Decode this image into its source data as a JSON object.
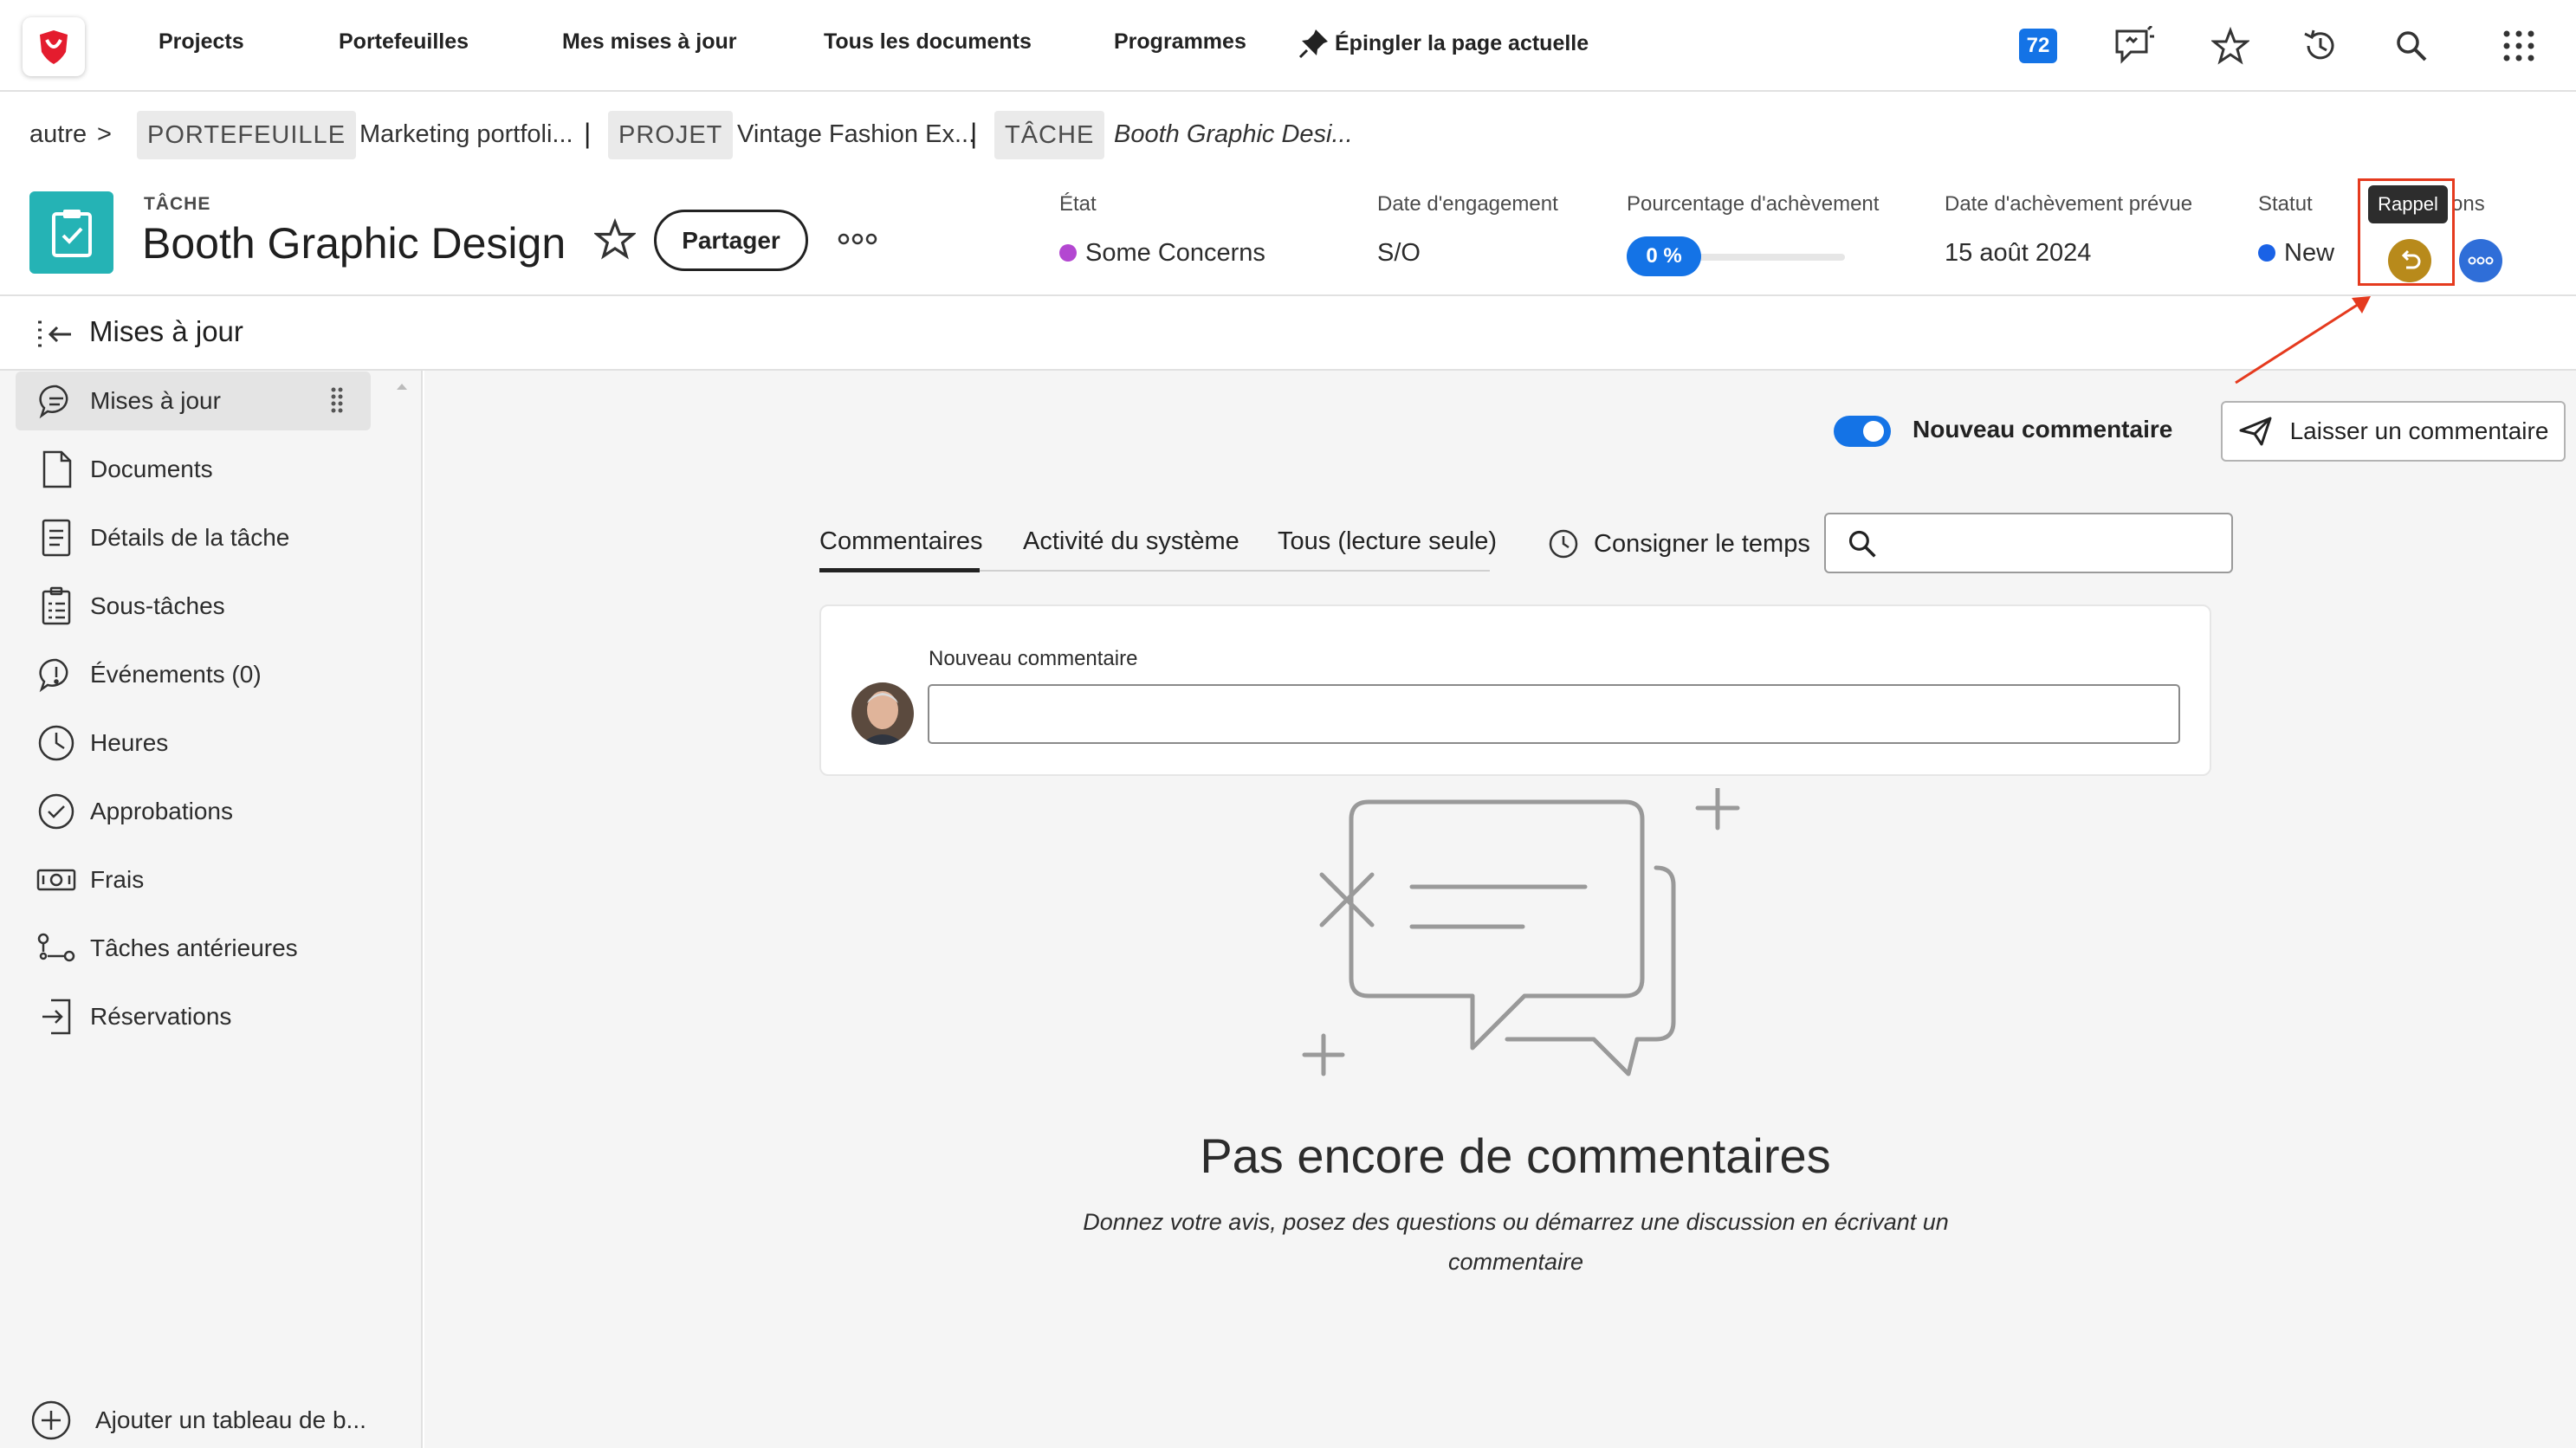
{
  "nav": {
    "links": [
      "Projects",
      "Portefeuilles",
      "Mes mises à jour",
      "Tous les documents",
      "Programmes"
    ],
    "pin_label": "Épingler la page actuelle",
    "notification_count": "72",
    "icons": [
      "whats-new-icon",
      "star-icon",
      "history-icon",
      "search-icon",
      "app-grid-icon"
    ]
  },
  "breadcrumb": {
    "root": "autre",
    "root_sep": ">",
    "portfolio_tag": "PORTEFEUILLE",
    "portfolio_name": "Marketing portfoli...",
    "project_tag": "PROJET",
    "project_name": "Vintage Fashion Ex...",
    "task_tag": "TÂCHE",
    "task_name": "Booth Graphic Desi...",
    "sep": "|"
  },
  "header": {
    "kind": "TÂCHE",
    "title": "Booth Graphic Design",
    "share_label": "Partager",
    "fields": {
      "condition_label": "État",
      "condition_value": "Some Concerns",
      "commit_label": "Date d'engagement",
      "commit_value": "S/O",
      "percent_label": "Pourcentage d'achèvement",
      "percent_value": "0 %",
      "percent_fraction": 0,
      "planned_label": "Date d'achèvement prévue",
      "planned_value": "15 août 2024",
      "status_label": "Statut",
      "status_value": "New",
      "actions_label_visible": "ons"
    },
    "tooltip": "Rappel"
  },
  "panel": {
    "title": "Mises à jour"
  },
  "sidebar": {
    "items": [
      {
        "label": "Mises à jour",
        "icon": "chat-bubble-icon"
      },
      {
        "label": "Documents",
        "icon": "document-icon"
      },
      {
        "label": "Détails de la tâche",
        "icon": "details-icon"
      },
      {
        "label": "Sous-tâches",
        "icon": "subtasks-icon"
      },
      {
        "label": "Événements (0)",
        "icon": "alert-bubble-icon"
      },
      {
        "label": "Heures",
        "icon": "clock-icon"
      },
      {
        "label": "Approbations",
        "icon": "check-circle-icon"
      },
      {
        "label": "Frais",
        "icon": "money-icon"
      },
      {
        "label": "Tâches antérieures",
        "icon": "predecessor-icon"
      },
      {
        "label": "Réservations",
        "icon": "booking-icon"
      }
    ],
    "add_dashboard": "Ajouter un tableau de b..."
  },
  "main": {
    "toggle_label": "Nouveau commentaire",
    "leave_comment": "Laisser un commentaire",
    "tabs": [
      "Commentaires",
      "Activité du système",
      "Tous (lecture seule)"
    ],
    "log_time": "Consigner le temps",
    "search_placeholder": "",
    "comment_label": "Nouveau commentaire",
    "comment_placeholder": "",
    "empty_title": "Pas encore de commentaires",
    "empty_subtitle": "Donnez votre avis, posez des questions ou démarrez une discussion en écrivant un commentaire"
  },
  "colors": {
    "accent": "#1473e6",
    "task_icon": "#25b3b5",
    "condition_dot": "#b347d1",
    "status_dot": "#1a62e6",
    "recall_button": "#b88a1b",
    "highlight": "#e53a1e"
  }
}
